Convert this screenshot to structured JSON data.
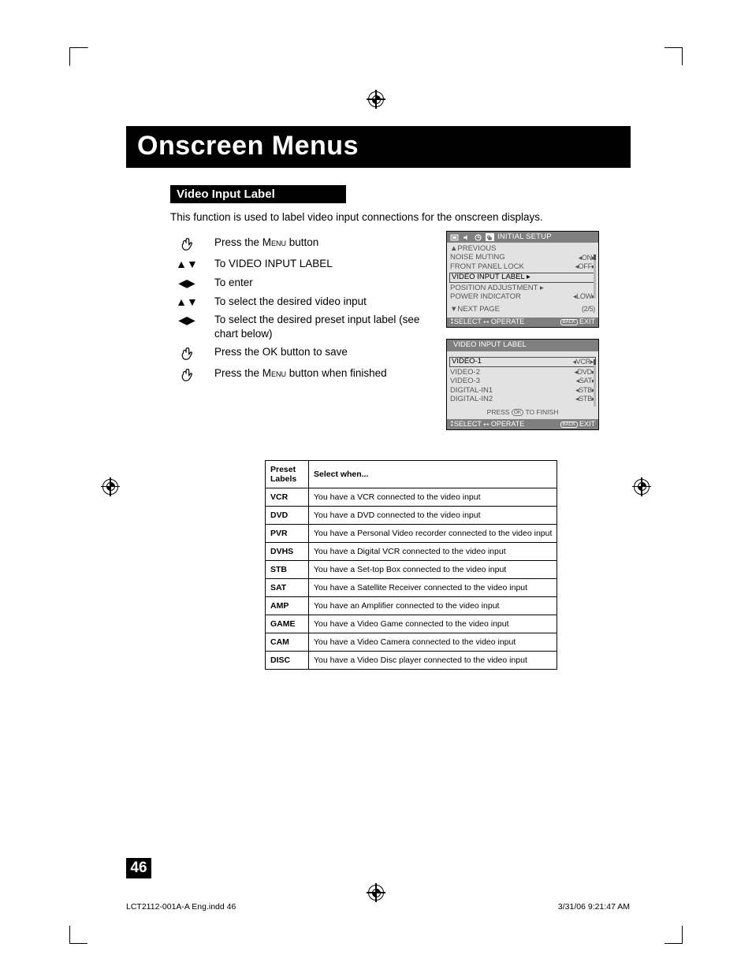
{
  "title": "Onscreen Menus",
  "section": {
    "label": "Video Input Label",
    "intro": "This function is used to label video input connections for the onscreen displays."
  },
  "steps": [
    {
      "icon": "hand",
      "text_pre": "Press the ",
      "text_sc": "Menu",
      "text_post": " button"
    },
    {
      "icon": "updown",
      "text_pre": "To VIDEO INPUT LABEL",
      "text_sc": "",
      "text_post": ""
    },
    {
      "icon": "leftright",
      "text_pre": "To enter",
      "text_sc": "",
      "text_post": ""
    },
    {
      "icon": "updown",
      "text_pre": "To select the desired video input",
      "text_sc": "",
      "text_post": ""
    },
    {
      "icon": "leftright",
      "text_pre": "To select the desired preset input label (see chart below)",
      "text_sc": "",
      "text_post": ""
    },
    {
      "icon": "hand",
      "text_pre": "Press the OK button to save",
      "text_sc": "",
      "text_post": ""
    },
    {
      "icon": "hand",
      "text_pre": "Press the ",
      "text_sc": "Menu",
      "text_post": " button when finished"
    }
  ],
  "osd1": {
    "header_title": "INITIAL SETUP",
    "rows": [
      {
        "label": "▲PREVIOUS",
        "value": ""
      },
      {
        "label": "NOISE MUTING",
        "value": "◂ON▸"
      },
      {
        "label": "FRONT PANEL LOCK",
        "value": "◂OFF▸"
      },
      {
        "label": "VIDEO INPUT LABEL ▸",
        "value": "",
        "boxed": true
      },
      {
        "label": "POSITION ADJUSTMENT ▸",
        "value": ""
      },
      {
        "label": "POWER INDICATOR",
        "value": "◂LOW▸"
      }
    ],
    "next_page": "▼NEXT PAGE",
    "page_indicator": "(2/5)",
    "footer_left": "⭥SELECT ⭤ OPERATE",
    "footer_right_label": "BACK",
    "footer_right_text": "EXIT"
  },
  "osd2": {
    "header_title": "VIDEO INPUT LABEL",
    "rows": [
      {
        "label": "VIDEO-1",
        "value": "◂VCR▸",
        "boxed": true
      },
      {
        "label": "VIDEO-2",
        "value": "◂DVD▸"
      },
      {
        "label": "VIDEO-3",
        "value": "◂SAT▸"
      },
      {
        "label": "DIGITAL-IN1",
        "value": "◂STB▸"
      },
      {
        "label": "DIGITAL-IN2",
        "value": "◂STB▸"
      }
    ],
    "press_line_pre": "PRESS ",
    "press_line_ok": "OK",
    "press_line_post": " TO FINISH",
    "footer_left": "⭥SELECT ⭤ OPERATE",
    "footer_right_label": "BACK",
    "footer_right_text": "EXIT"
  },
  "preset_table": {
    "head": [
      "Preset Labels",
      "Select when..."
    ],
    "rows": [
      [
        "VCR",
        "You have a VCR connected to the video input"
      ],
      [
        "DVD",
        "You have a DVD connected to the video input"
      ],
      [
        "PVR",
        "You have a Personal Video recorder connected to the video input"
      ],
      [
        "DVHS",
        "You have a Digital VCR connected to the video input"
      ],
      [
        "STB",
        "You have a Set-top Box connected to the video input"
      ],
      [
        "SAT",
        "You have a Satellite Receiver connected to the video input"
      ],
      [
        "AMP",
        "You have an Amplifier connected to the video input"
      ],
      [
        "GAME",
        "You have a Video Game connected to the video input"
      ],
      [
        "CAM",
        "You have a Video Camera connected to the video input"
      ],
      [
        "DISC",
        "You have a Video Disc player connected to the video input"
      ]
    ]
  },
  "page_number": "46",
  "footer": {
    "left": "LCT2112-001A-A Eng.indd   46",
    "right": "3/31/06   9:21:47 AM"
  }
}
